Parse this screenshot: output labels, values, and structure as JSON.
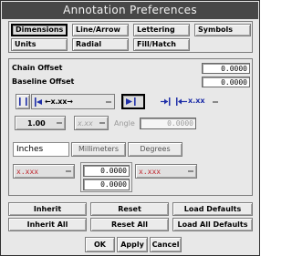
{
  "window": {
    "title": "Annotation Preferences"
  },
  "tabs": [
    {
      "label": "Dimensions",
      "active": true
    },
    {
      "label": "Line/Arrow",
      "active": false
    },
    {
      "label": "Lettering",
      "active": false
    },
    {
      "label": "Symbols",
      "active": false
    },
    {
      "label": "Units",
      "active": false
    },
    {
      "label": "Radial",
      "active": false
    },
    {
      "label": "Fill/Hatch",
      "active": false
    }
  ],
  "offsets": {
    "chain_label": "Chain Offset",
    "chain_value": "0.0000",
    "baseline_label": "Baseline Offset",
    "baseline_value": "0.0000"
  },
  "arrows_row": {
    "text_position_glyph": "←x.xx→",
    "right_glyph": "x.xx"
  },
  "text_row": {
    "size_value": "1.00",
    "angle_glyph": "x.xx",
    "angle_label": "Angle",
    "angle_value": "0.0000"
  },
  "units_row": {
    "unit_value": "Inches",
    "millimeters_label": "Millimeters",
    "degrees_label": "Degrees"
  },
  "tolerance_row": {
    "left_glyph": "x.xxx",
    "upper_value": "0.0000",
    "lower_value": "0.0000",
    "right_glyph": "x.xxx"
  },
  "actions": {
    "inherit": "Inherit",
    "reset": "Reset",
    "load_defaults": "Load Defaults",
    "inherit_all": "Inherit All",
    "reset_all": "Reset All",
    "load_all_defaults": "Load All Defaults"
  },
  "footer": {
    "ok": "OK",
    "apply": "Apply",
    "cancel": "Cancel"
  },
  "colors": {
    "title_bar": "#474747",
    "red_text": "#c0262e"
  }
}
